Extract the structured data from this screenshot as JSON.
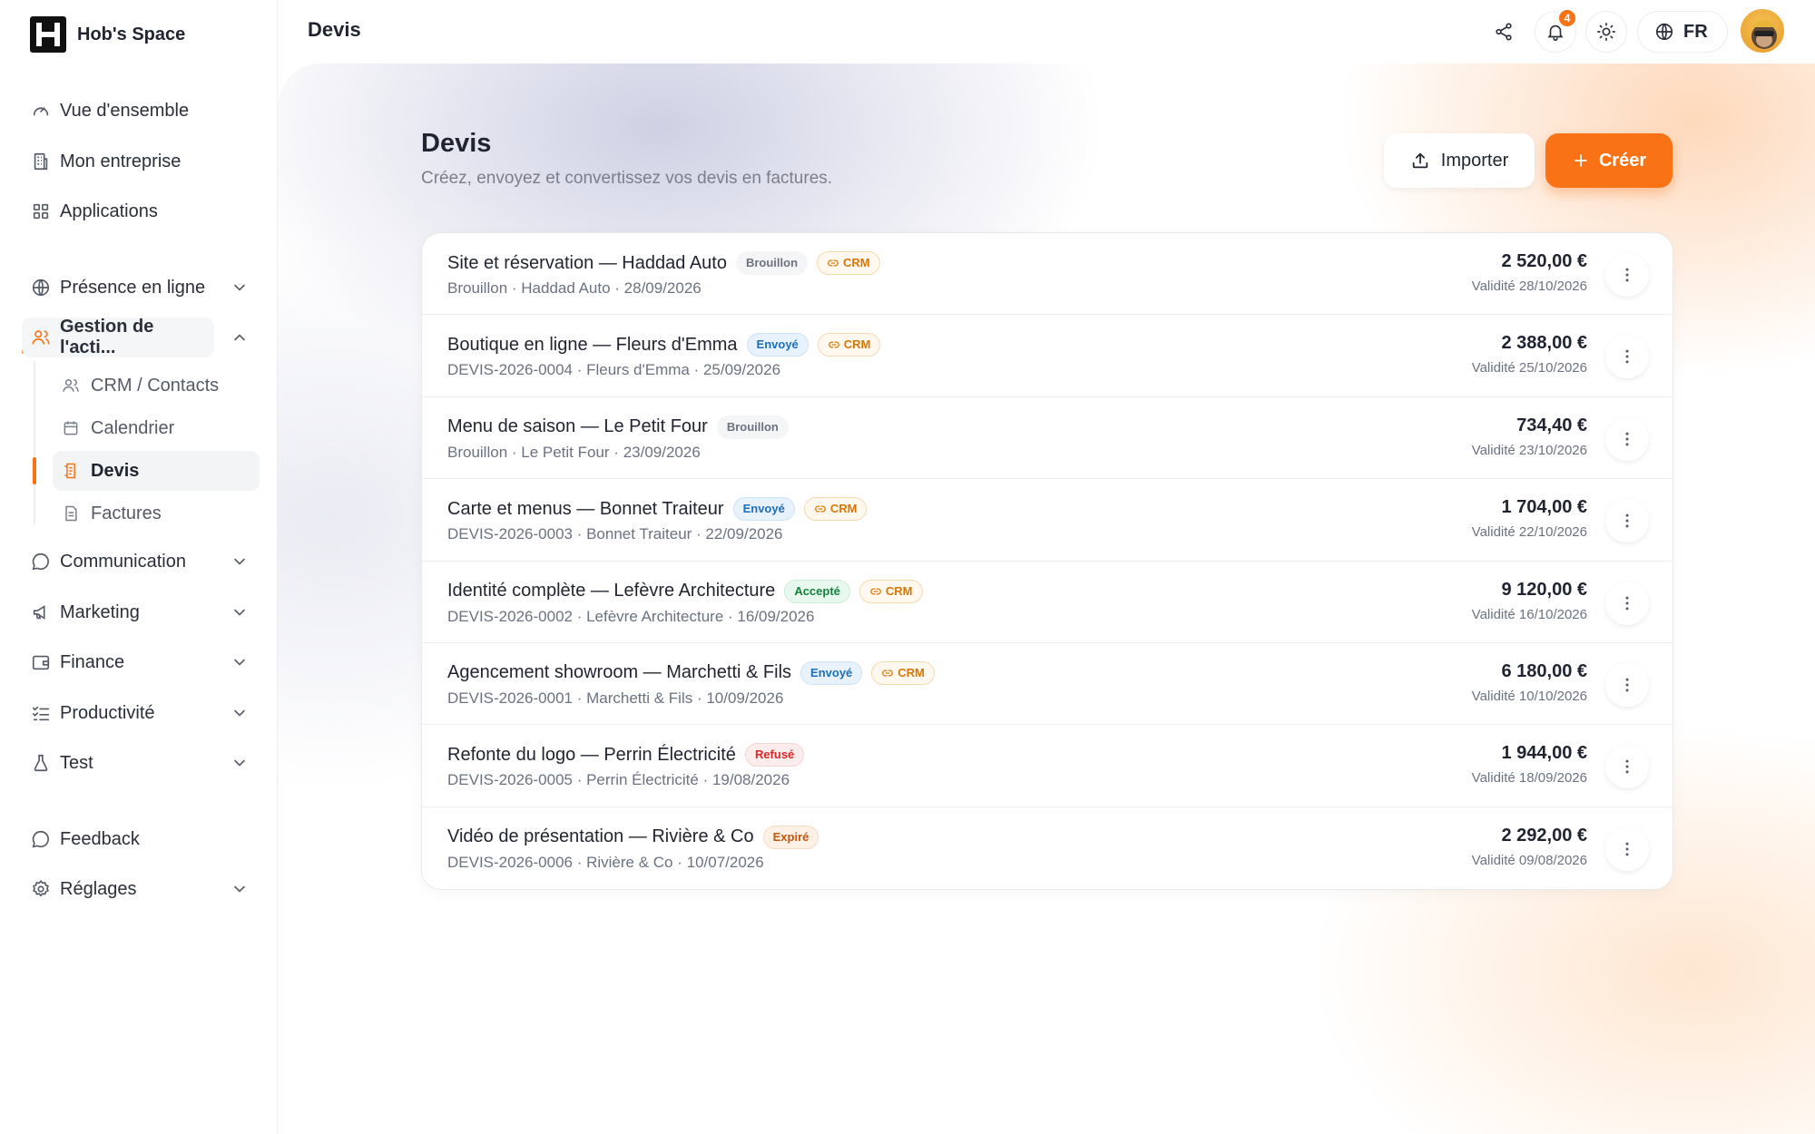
{
  "app": {
    "brand_name": "Hob's Space"
  },
  "sidebar": {
    "top_items": [
      {
        "label": "Vue d'ensemble",
        "icon": "gauge-icon"
      },
      {
        "label": "Mon entreprise",
        "icon": "building-icon"
      },
      {
        "label": "Applications",
        "icon": "grid-icon"
      }
    ],
    "groups": [
      {
        "label": "Présence en ligne",
        "icon": "globe-icon",
        "expanded": false
      },
      {
        "label": "Gestion de l'acti...",
        "icon": "users-icon",
        "expanded": true,
        "active": true
      },
      {
        "label": "Communication",
        "icon": "chat-icon",
        "expanded": false
      },
      {
        "label": "Marketing",
        "icon": "megaphone-icon",
        "expanded": false
      },
      {
        "label": "Finance",
        "icon": "wallet-icon",
        "expanded": false
      },
      {
        "label": "Productivité",
        "icon": "checklist-icon",
        "expanded": false
      },
      {
        "label": "Test",
        "icon": "flask-icon",
        "expanded": false
      }
    ],
    "sub_items": [
      {
        "label": "CRM / Contacts",
        "icon": "users-icon"
      },
      {
        "label": "Calendrier",
        "icon": "calendar-icon"
      },
      {
        "label": "Devis",
        "icon": "quote-icon",
        "active": true
      },
      {
        "label": "Factures",
        "icon": "invoice-icon"
      }
    ],
    "bottom_items": [
      {
        "label": "Feedback",
        "icon": "chat-icon"
      },
      {
        "label": "Réglages",
        "icon": "gear-icon",
        "expandable": true
      }
    ]
  },
  "topbar": {
    "page_title": "Devis",
    "notifications_count": "4",
    "language": "FR"
  },
  "main": {
    "title": "Devis",
    "subtitle": "Créez, envoyez et convertissez vos devis en factures.",
    "import_label": "Importer",
    "create_label": "Créer"
  },
  "quotes": [
    {
      "title": "Site et réservation — Haddad Auto",
      "status": "Brouillon",
      "status_type": "draft",
      "crm": "CRM",
      "meta": "Brouillon · Haddad Auto · 28/09/2026",
      "amount": "2 520,00 €",
      "validity": "Validité 28/10/2026"
    },
    {
      "title": "Boutique en ligne — Fleurs d'Emma",
      "status": "Envoyé",
      "status_type": "sent",
      "crm": "CRM",
      "meta": "DEVIS-2026-0004 · Fleurs d'Emma · 25/09/2026",
      "amount": "2 388,00 €",
      "validity": "Validité 25/10/2026"
    },
    {
      "title": "Menu de saison — Le Petit Four",
      "status": "Brouillon",
      "status_type": "draft",
      "crm": "",
      "meta": "Brouillon · Le Petit Four · 23/09/2026",
      "amount": "734,40 €",
      "validity": "Validité 23/10/2026"
    },
    {
      "title": "Carte et menus — Bonnet Traiteur",
      "status": "Envoyé",
      "status_type": "sent",
      "crm": "CRM",
      "meta": "DEVIS-2026-0003 · Bonnet Traiteur · 22/09/2026",
      "amount": "1 704,00 €",
      "validity": "Validité 22/10/2026"
    },
    {
      "title": "Identité complète — Lefèvre Architecture",
      "status": "Accepté",
      "status_type": "accepted",
      "crm": "CRM",
      "meta": "DEVIS-2026-0002 · Lefèvre Architecture · 16/09/2026",
      "amount": "9 120,00 €",
      "validity": "Validité 16/10/2026"
    },
    {
      "title": "Agencement showroom — Marchetti & Fils",
      "status": "Envoyé",
      "status_type": "sent",
      "crm": "CRM",
      "meta": "DEVIS-2026-0001 · Marchetti & Fils · 10/09/2026",
      "amount": "6 180,00 €",
      "validity": "Validité 10/10/2026"
    },
    {
      "title": "Refonte du logo — Perrin Électricité",
      "status": "Refusé",
      "status_type": "refused",
      "crm": "",
      "meta": "DEVIS-2026-0005 · Perrin Électricité · 19/08/2026",
      "amount": "1 944,00 €",
      "validity": "Validité 18/09/2026"
    },
    {
      "title": "Vidéo de présentation — Rivière & Co",
      "status": "Expiré",
      "status_type": "expired",
      "crm": "",
      "meta": "DEVIS-2026-0006 · Rivière & Co · 10/07/2026",
      "amount": "2 292,00 €",
      "validity": "Validité 09/08/2026"
    }
  ],
  "colors": {
    "accent": "#f97316",
    "text": "#1f2430",
    "muted": "#6b7280"
  }
}
